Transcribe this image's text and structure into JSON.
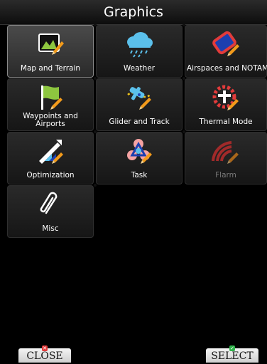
{
  "window": {
    "title": "Graphics"
  },
  "menu": {
    "items": [
      {
        "label": "Map and Terrain",
        "icon": "map-terrain-icon",
        "selected": true,
        "enabled": true
      },
      {
        "label": "Weather",
        "icon": "weather-cloud-icon",
        "selected": false,
        "enabled": true
      },
      {
        "label": "Airspaces and NOTAM",
        "icon": "airspace-icon",
        "selected": false,
        "enabled": true
      },
      {
        "label": "Waypoints and Airports",
        "icon": "waypoint-flag-icon",
        "selected": false,
        "enabled": true
      },
      {
        "label": "Glider and Track",
        "icon": "glider-icon",
        "selected": false,
        "enabled": true
      },
      {
        "label": "Thermal Mode",
        "icon": "thermal-icon",
        "selected": false,
        "enabled": true
      },
      {
        "label": "Optimization",
        "icon": "optimization-icon",
        "selected": false,
        "enabled": true
      },
      {
        "label": "Task",
        "icon": "task-icon",
        "selected": false,
        "enabled": true
      },
      {
        "label": "Flarm",
        "icon": "flarm-icon",
        "selected": false,
        "enabled": false
      },
      {
        "label": "Misc",
        "icon": "paperclip-icon",
        "selected": false,
        "enabled": true
      }
    ]
  },
  "footer": {
    "close_label": "CLOSE",
    "select_label": "SELECT"
  },
  "colors": {
    "accent_yellow": "#f0c419",
    "pencil_orange": "#f29a1a",
    "close_badge": "#e23b3b",
    "select_badge": "#2fb34a",
    "disabled_text": "#7a7a7a"
  }
}
